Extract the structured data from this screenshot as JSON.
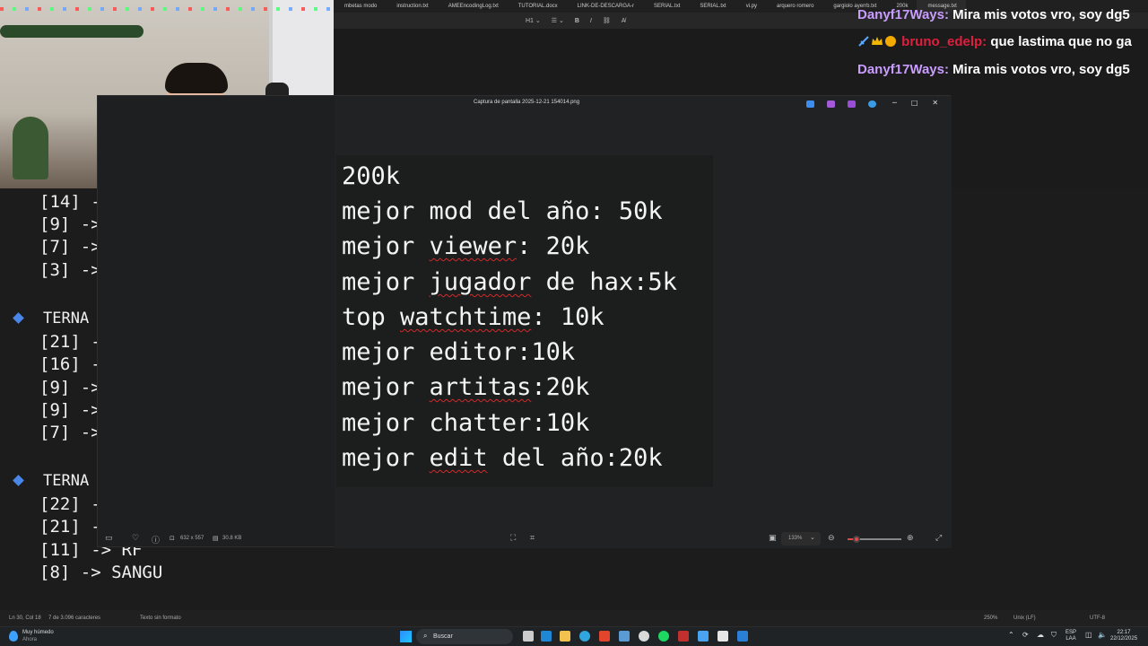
{
  "notepad": {
    "tabs": [
      "mbetas modo",
      "instruction.txt",
      "AMEEncodingLog.txt",
      "TUTORIAL.docx",
      "LINK-DE-DESCARGA-r",
      "SERIAL.txt",
      "SERIAL.txt",
      "vi.py",
      "arquero romero",
      "gargiolo ayerrb.txt",
      "200k",
      "message.txt"
    ],
    "format_bar": [
      "H1 ⌄",
      "☰ ⌄",
      "B",
      "I",
      "⛓",
      "A̸"
    ],
    "lines_top": [
      "[14] -",
      "[9] ->",
      "[7] ->",
      "[3] ->"
    ],
    "heading_1": "TERNA",
    "lines_mid": [
      "[21] -",
      "[16] -",
      "[9] ->",
      "[9] ->",
      "[7] ->"
    ],
    "heading_2": "TERNA",
    "lines_bottom": [
      "[22] -",
      "[21] -",
      "[11] -> RF",
      "[8] -> SANGU"
    ],
    "status": {
      "position": "Ln 30, Col 18",
      "chars": "7 de 3.096 caracteres",
      "format": "Texto sin formato",
      "zoom": "250%",
      "line_ending": "Unix (LF)",
      "encoding": "UTF-8"
    }
  },
  "chat": [
    {
      "user": "Danyf17Ways:",
      "text": "Mira mis votos vro, soy dg5"
    },
    {
      "user": "bruno_edelp:",
      "text": "que lastima que no ga"
    },
    {
      "user": "Danyf17Ways:",
      "text": "Mira mis votos vro, soy dg5"
    }
  ],
  "viewer": {
    "title": "Captura de pantalla 2025-12-21 154014.png",
    "window_buttons": [
      "─",
      "□",
      "✕"
    ],
    "image_lines": [
      "200k",
      "mejor mod del año: 50k",
      "mejor viewer: 20k",
      "mejor jugador de hax:5k",
      "top watchtime: 10k",
      "mejor editor:10k",
      "mejor artitas:20k",
      "mejor chatter:10k",
      "mejor edit del año:20k"
    ],
    "dimensions": "632 x 557",
    "file_size": "30.8 KB",
    "zoom": "133%"
  },
  "taskbar": {
    "weather": "Muy húmedo",
    "weather_sub": "Ahora",
    "search": "Buscar",
    "lang_top": "ESP",
    "lang_bottom": "LAA",
    "time": "22:17",
    "date": "22/12/2025"
  },
  "colors": {
    "chat_user_purple": "#c99cff",
    "chat_user_red": "#e01f3d",
    "spellcheck": "#d12a2a",
    "bullet": "#4a86e8"
  }
}
